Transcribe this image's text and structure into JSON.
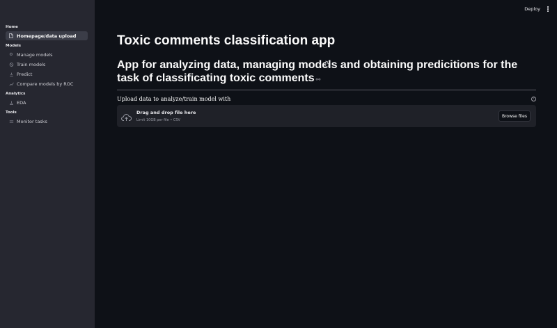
{
  "sidebar": {
    "sections": [
      {
        "title": "Home",
        "items": [
          {
            "label": "Homepage/data upload",
            "icon": "document-icon",
            "active": true
          }
        ]
      },
      {
        "title": "Models",
        "items": [
          {
            "label": "Manage models",
            "icon": "gear-icon"
          },
          {
            "label": "Train models",
            "icon": "dumbbell-icon"
          },
          {
            "label": "Predict",
            "icon": "predict-icon"
          },
          {
            "label": "Compare models by ROC",
            "icon": "chart-icon"
          }
        ]
      },
      {
        "title": "Analytics",
        "items": [
          {
            "label": "EDA",
            "icon": "analytics-icon"
          }
        ]
      },
      {
        "title": "Tools",
        "items": [
          {
            "label": "Monitor tasks",
            "icon": "list-icon"
          }
        ]
      }
    ]
  },
  "header": {
    "deploy_label": "Deploy",
    "menu_icon": "kebab-menu-icon"
  },
  "main": {
    "title": "Toxic comments classification app",
    "subtitle": "App for analyzing data, managing models and obtaining predicitions for the task of classificating toxic comments",
    "uploader": {
      "label": "Upload data to analyze/train model with",
      "drop_text": "Drag and drop file here",
      "limit_text": "Limit 10GB per file • CSV",
      "browse_label": "Browse files",
      "help_icon": "help-icon",
      "upload_icon": "cloud-upload-icon"
    }
  },
  "colors": {
    "background": "#0e1117",
    "sidebar": "#262730",
    "dropzone": "#1f2128",
    "active_item": "#3b3d48",
    "text": "#fafafa"
  }
}
